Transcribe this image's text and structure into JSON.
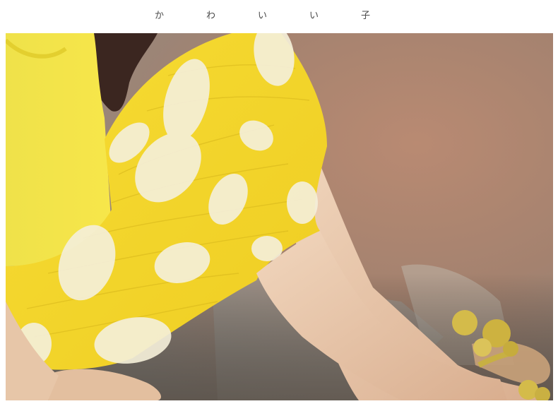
{
  "header": {
    "title_chars": [
      "か",
      "わ",
      "い",
      "い",
      "子"
    ]
  },
  "photo": {
    "subject": "photo-girl-yellow-polka-dot-outfit",
    "colors": {
      "outfit_yellow": "#f5e23a",
      "dots_white": "#f4efd8",
      "floor_rust": "#b07a5e",
      "floor_grey": "#a9a7a0",
      "skin": "#e9c9ad",
      "sandal_gold": "#cdb54a"
    }
  }
}
